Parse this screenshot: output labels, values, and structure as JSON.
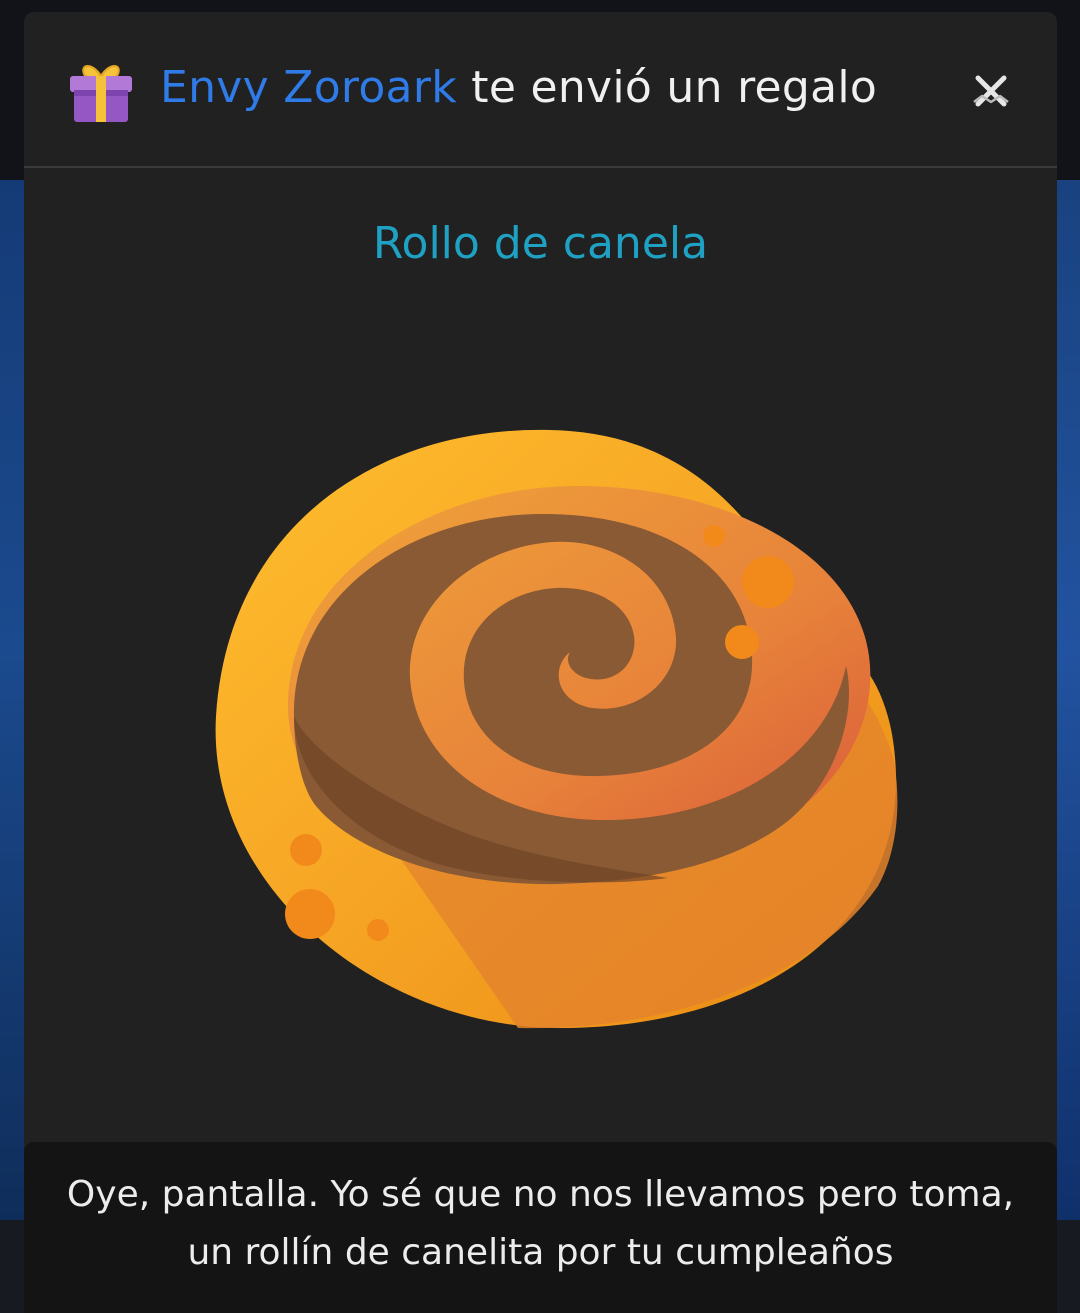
{
  "dialog": {
    "sender_name": "Envy Zoroark",
    "title_suffix": " te envió un regalo",
    "gift_icon": "gift-icon",
    "close_icon": "close-icon"
  },
  "item": {
    "name": "Rollo de canela",
    "image_icon": "cinnamon-roll-icon"
  },
  "message": {
    "text": "Oye, pantalla. Yo sé que no nos llevamos pero toma, un rollín de canelita por tu cumpleaños"
  },
  "colors": {
    "sender": "#2f7be8",
    "item_title": "#1fa1c3",
    "modal_bg": "#212121",
    "message_bg": "#141414"
  }
}
